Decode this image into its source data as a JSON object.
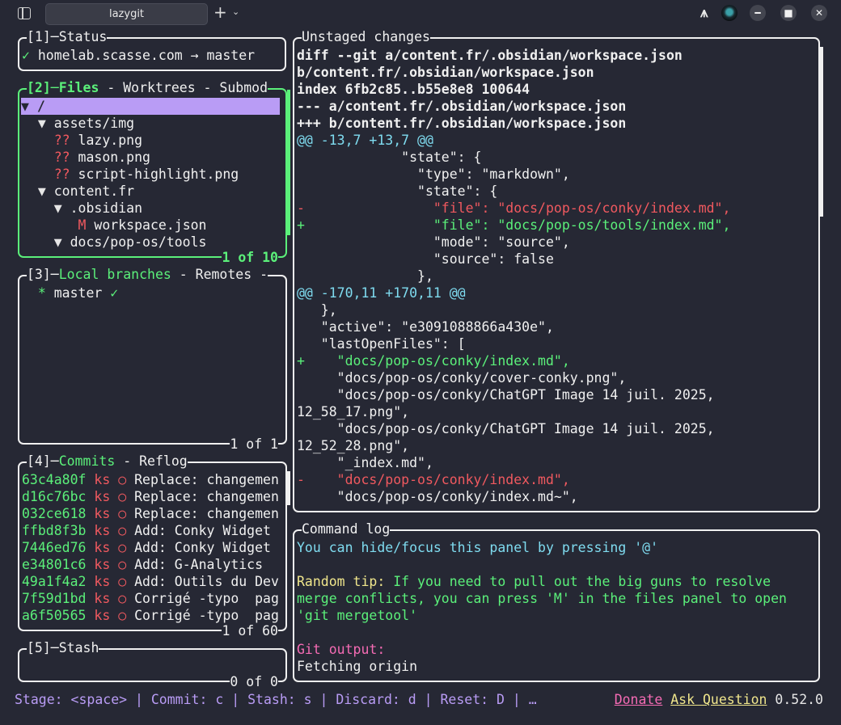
{
  "window": {
    "tab_title": "lazygit",
    "icons": [
      "sidebar-icon",
      "plus-icon",
      "chevron-down-icon",
      "arch-icon",
      "avatar",
      "minimize-icon",
      "maximize-icon",
      "close-icon"
    ],
    "plus": "+",
    "chevron": "⌄",
    "arch": "⩚",
    "min": "━",
    "max": "■",
    "close": "✕"
  },
  "status": {
    "title": "[1]─Status",
    "check": "✓",
    "repo": "homelab.scasse.com",
    "arrow": "→",
    "branch": "master"
  },
  "files": {
    "title_num": "[2]─",
    "title_active": "Files",
    "title_rest": " - Worktrees - Submod",
    "footer": "1 of 10",
    "tree": [
      {
        "prefix": "▼ ",
        "marker": "",
        "name": "/"
      },
      {
        "prefix": "  ▼ ",
        "marker": "",
        "name": "assets/img"
      },
      {
        "prefix": "    ",
        "marker": "??",
        "name": " lazy.png"
      },
      {
        "prefix": "    ",
        "marker": "??",
        "name": " mason.png"
      },
      {
        "prefix": "    ",
        "marker": "??",
        "name": " script-highlight.png"
      },
      {
        "prefix": "  ▼ ",
        "marker": "",
        "name": "content.fr"
      },
      {
        "prefix": "    ▼ ",
        "marker": "",
        "name": ".obsidian"
      },
      {
        "prefix": "       ",
        "marker": "M",
        "name": " workspace.json"
      },
      {
        "prefix": "    ▼ ",
        "marker": "",
        "name": "docs/pop-os/tools"
      }
    ]
  },
  "branches": {
    "title_num": "[3]─",
    "title_active": "Local branches",
    "title_rest": " - Remotes -",
    "footer": "1 of 1",
    "items": [
      {
        "star": "*",
        "name": "master",
        "check": "✓"
      }
    ]
  },
  "commits": {
    "title_num": "[4]─",
    "title_active": "Commits",
    "title_rest": " - Reflog",
    "footer": "1 of 60",
    "rows": [
      {
        "hash": "63c4a80f",
        "author": "ks",
        "dot": "○",
        "msg": "Replace: changemen"
      },
      {
        "hash": "d16c76bc",
        "author": "ks",
        "dot": "○",
        "msg": "Replace: changemen"
      },
      {
        "hash": "032ce618",
        "author": "ks",
        "dot": "○",
        "msg": "Replace: changemen"
      },
      {
        "hash": "ffbd8f3b",
        "author": "ks",
        "dot": "○",
        "msg": "Add: Conky Widget"
      },
      {
        "hash": "7446ed76",
        "author": "ks",
        "dot": "○",
        "msg": "Add: Conky Widget"
      },
      {
        "hash": "e34801c6",
        "author": "ks",
        "dot": "○",
        "msg": "Add: G-Analytics"
      },
      {
        "hash": "49a1f4a2",
        "author": "ks",
        "dot": "○",
        "msg": "Add: Outils du Dev"
      },
      {
        "hash": "7f59d1bd",
        "author": "ks",
        "dot": "○",
        "msg": "Corrigé -typo  pag"
      },
      {
        "hash": "a6f50565",
        "author": "ks",
        "dot": "○",
        "msg": "Corrigé -typo  pag"
      }
    ]
  },
  "stash": {
    "title": "[5]─Stash",
    "footer": "0 of 0"
  },
  "diff": {
    "title": "Unstaged changes",
    "lines": [
      {
        "text": "diff --git a/content.fr/.obsidian/workspace.json",
        "style": "white bold"
      },
      {
        "text": "b/content.fr/.obsidian/workspace.json",
        "style": "white bold"
      },
      {
        "text": "index 6fb2c85..b55e8e8 100644",
        "style": "white bold"
      },
      {
        "text": "--- a/content.fr/.obsidian/workspace.json",
        "style": "white bold"
      },
      {
        "text": "+++ b/content.fr/.obsidian/workspace.json",
        "style": "white bold"
      },
      {
        "text": "@@ -13,7 +13,7 @@",
        "style": "cyan"
      },
      {
        "text": "             \"state\": {",
        "style": "white"
      },
      {
        "text": "               \"type\": \"markdown\",",
        "style": "white"
      },
      {
        "text": "               \"state\": {",
        "style": "white"
      },
      {
        "text": "-                \"file\": \"docs/pop-os/conky/index.md\",",
        "style": "red"
      },
      {
        "text": "+                \"file\": \"docs/pop-os/tools/index.md\",",
        "style": "green"
      },
      {
        "text": "                 \"mode\": \"source\",",
        "style": "white"
      },
      {
        "text": "                 \"source\": false",
        "style": "white"
      },
      {
        "text": "               },",
        "style": "white"
      },
      {
        "text": "@@ -170,11 +170,11 @@",
        "style": "cyan"
      },
      {
        "text": "   },",
        "style": "white"
      },
      {
        "text": "   \"active\": \"e3091088866a430e\",",
        "style": "white"
      },
      {
        "text": "   \"lastOpenFiles\": [",
        "style": "white"
      },
      {
        "text": "+    \"docs/pop-os/conky/index.md\",",
        "style": "green"
      },
      {
        "text": "     \"docs/pop-os/conky/cover-conky.png\",",
        "style": "white"
      },
      {
        "text": "     \"docs/pop-os/conky/ChatGPT Image 14 juil. 2025,",
        "style": "white"
      },
      {
        "text": "12_58_17.png\",",
        "style": "white"
      },
      {
        "text": "     \"docs/pop-os/conky/ChatGPT Image 14 juil. 2025,",
        "style": "white"
      },
      {
        "text": "12_52_28.png\",",
        "style": "white"
      },
      {
        "text": "     \"_index.md\",",
        "style": "white"
      },
      {
        "text": "-    \"docs/pop-os/conky/index.md\",",
        "style": "red"
      },
      {
        "text": "     \"docs/pop-os/conky/index.md~\",",
        "style": "white"
      }
    ]
  },
  "command_log": {
    "title": "Command log",
    "hint": "You can hide/focus this panel by pressing '@'",
    "tip_label": "Random tip:",
    "tip_line1": " If you need to pull out the big guns to resolve",
    "tip_line2": "merge conflicts, you can press 'M' in the files panel to open",
    "tip_line3": "'git mergetool'",
    "git_output_label": "Git output:",
    "git_output": "Fetching origin"
  },
  "statusbar": {
    "keys": "Stage: <space> | Commit: c | Stash: s | Discard: d | Reset: D | …",
    "donate": "Donate",
    "ask": "Ask Question",
    "version": "0.52.0"
  },
  "colors": {
    "background": "#262834",
    "active_border": "#5bf07a",
    "selection": "#b99cf5",
    "added": "#5bf07a",
    "removed": "#f0595f",
    "hunk": "#7fdcf0"
  }
}
